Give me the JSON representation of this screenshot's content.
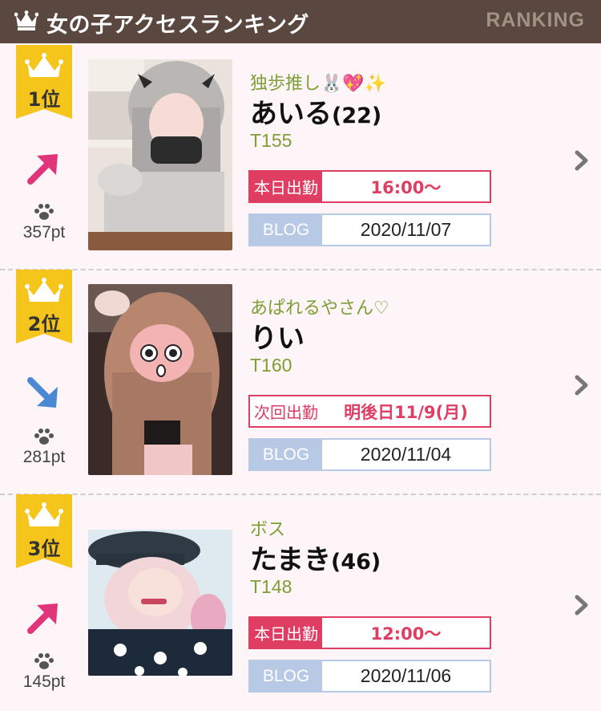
{
  "header": {
    "title": "女の子アクセスランキング",
    "english": "RANKING"
  },
  "entries": [
    {
      "rank": "1位",
      "trend": "up",
      "points": "357pt",
      "catchphrase": "独歩推し🐰💖✨",
      "name": "あいる",
      "age": "(22)",
      "height": "T155",
      "work_label": "本日出勤",
      "work_type": "today",
      "work_time": "16:00〜",
      "blog_label": "BLOG",
      "blog_date": "2020/11/07"
    },
    {
      "rank": "2位",
      "trend": "down",
      "points": "281pt",
      "catchphrase": "あぱれるやさん♡",
      "name": "りい",
      "age": "",
      "height": "T160",
      "work_label": "次回出勤",
      "work_type": "next",
      "work_time": "明後日11/9(月)",
      "blog_label": "BLOG",
      "blog_date": "2020/11/04"
    },
    {
      "rank": "3位",
      "trend": "up",
      "points": "145pt",
      "catchphrase": "ボス",
      "name": "たまき",
      "age": "(46)",
      "height": "T148",
      "work_label": "本日出勤",
      "work_type": "today",
      "work_time": "12:00〜",
      "blog_label": "BLOG",
      "blog_date": "2020/11/06"
    }
  ],
  "colors": {
    "header_bg": "#5a473f",
    "accent_pink": "#e03d63",
    "catch_green": "#7e9e36",
    "blog_blue": "#b8c9e6",
    "crown_gold": "#f5c51b"
  }
}
